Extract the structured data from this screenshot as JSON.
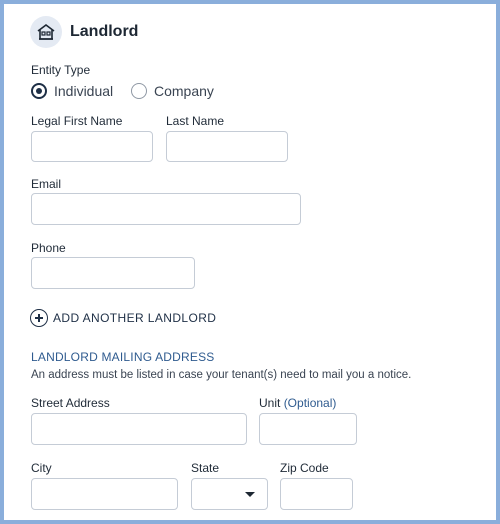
{
  "header": {
    "title": "Landlord",
    "icon": "house-icon"
  },
  "entity_type": {
    "label": "Entity Type",
    "options": [
      {
        "label": "Individual",
        "selected": true
      },
      {
        "label": "Company",
        "selected": false
      }
    ]
  },
  "fields": {
    "first_name": {
      "label": "Legal First Name",
      "value": ""
    },
    "last_name": {
      "label": "Last Name",
      "value": ""
    },
    "email": {
      "label": "Email",
      "value": ""
    },
    "phone": {
      "label": "Phone",
      "value": ""
    }
  },
  "add_landlord": {
    "label": "ADD ANOTHER LANDLORD",
    "icon": "plus-circle-icon"
  },
  "mailing": {
    "title": "LANDLORD MAILING ADDRESS",
    "description": "An address must be listed in case your tenant(s) need to mail you a notice.",
    "street": {
      "label": "Street Address",
      "value": ""
    },
    "unit": {
      "label": "Unit",
      "optional": "(Optional)",
      "value": ""
    },
    "city": {
      "label": "City",
      "value": ""
    },
    "state": {
      "label": "State",
      "value": ""
    },
    "zip": {
      "label": "Zip Code",
      "value": ""
    }
  },
  "colors": {
    "border": "#8aaedb",
    "accent": "#2f5b8f",
    "dark": "#1e2f46"
  }
}
